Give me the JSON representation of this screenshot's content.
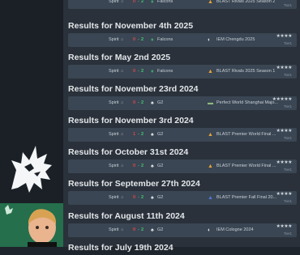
{
  "sidebar": {
    "team_logo_icon": "spirit-dragon-logo",
    "player_card_badge_icon": "spirit-dragon-logo"
  },
  "colors": {
    "win": "#3ecf6e",
    "loss": "#e04848",
    "row_bg": "#3a4653",
    "page_bg": "#2a313a"
  },
  "results": [
    {
      "title": "",
      "match": {
        "team": "Spirit",
        "score_left": "0",
        "dash": "-",
        "score_right": "2",
        "left_result": "loss",
        "right_result": "win",
        "opponent": "Falcons",
        "opponent_icon": "falcons-logo",
        "event": "BLAST Rivals 2025 Season 2",
        "event_icon": "blast-logo",
        "stars": "★★★★",
        "tier": "Tier1"
      }
    },
    {
      "title": "Results for November 4th 2025",
      "match": {
        "team": "Spirit",
        "score_left": "0",
        "dash": "-",
        "score_right": "2",
        "left_result": "loss",
        "right_result": "win",
        "opponent": "Falcons",
        "opponent_icon": "falcons-logo",
        "event": "IEM Chengdu 2025",
        "event_icon": "iem-logo",
        "stars": "★★★★",
        "tier": "Tier1"
      }
    },
    {
      "title": "Results for May 2nd 2025",
      "match": {
        "team": "Spirit",
        "score_left": "0",
        "dash": "-",
        "score_right": "2",
        "left_result": "loss",
        "right_result": "win",
        "opponent": "Falcons",
        "opponent_icon": "falcons-logo",
        "event": "BLAST Rivals 2025 Season 1",
        "event_icon": "blast-logo",
        "stars": "★★★★",
        "tier": "Tier1"
      }
    },
    {
      "title": "Results for November 23rd 2024",
      "match": {
        "team": "Spirit",
        "score_left": "0",
        "dash": "-",
        "score_right": "2",
        "left_result": "loss",
        "right_result": "win",
        "opponent": "G2",
        "opponent_icon": "g2-logo",
        "event": "Perfect World Shanghai Majo...",
        "event_icon": "perfect-world-logo",
        "stars": "★★★★★",
        "tier": "Tier1"
      }
    },
    {
      "title": "Results for November 3rd 2024",
      "match": {
        "team": "Spirit",
        "score_left": "1",
        "dash": "-",
        "score_right": "2",
        "left_result": "loss",
        "right_result": "win",
        "opponent": "G2",
        "opponent_icon": "g2-logo",
        "event": "BLAST Premier World Final ...",
        "event_icon": "blast-logo",
        "stars": "★★★★",
        "tier": "Tier1"
      }
    },
    {
      "title": "Results for October 31st 2024",
      "match": {
        "team": "Spirit",
        "score_left": "0",
        "dash": "-",
        "score_right": "2",
        "left_result": "loss",
        "right_result": "win",
        "opponent": "G2",
        "opponent_icon": "g2-logo",
        "event": "BLAST Premier World Final ...",
        "event_icon": "blast-logo",
        "stars": "★★★★",
        "tier": "Tier1"
      }
    },
    {
      "title": "Results for September 27th 2024",
      "match": {
        "team": "Spirit",
        "score_left": "0",
        "dash": "-",
        "score_right": "2",
        "left_result": "loss",
        "right_result": "win",
        "opponent": "G2",
        "opponent_icon": "g2-logo",
        "event": "BLAST Premier Fall Final 20...",
        "event_icon": "blast-blue-logo",
        "stars": "★★★★",
        "tier": "Tier1"
      }
    },
    {
      "title": "Results for August 11th 2024",
      "match": {
        "team": "Spirit",
        "score_left": "0",
        "dash": "-",
        "score_right": "2",
        "left_result": "loss",
        "right_result": "win",
        "opponent": "G2",
        "opponent_icon": "g2-logo",
        "event": "IEM Cologne 2024",
        "event_icon": "iem-logo",
        "stars": "★★★★",
        "tier": "Tier1"
      }
    }
  ],
  "partial_title": "Results for July 19th 2024"
}
